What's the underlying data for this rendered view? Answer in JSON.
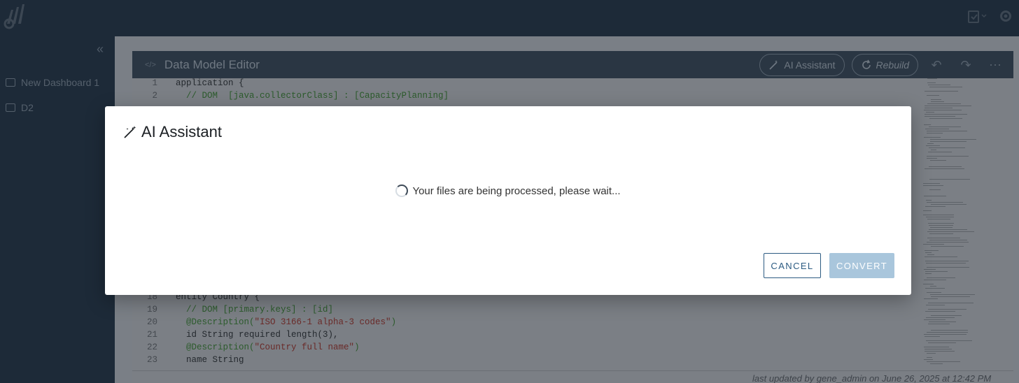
{
  "sidebar": {
    "items": [
      {
        "label": "New Dashboard 1"
      },
      {
        "label": "D2"
      }
    ]
  },
  "editor": {
    "title": "Data Model Editor",
    "ai_button": "AI Assistant",
    "rebuild_button": "Rebuild",
    "lines": [
      {
        "n": "1",
        "text": "application {"
      },
      {
        "n": "2",
        "comment": "  // DOM  [java.collectorClass] : [CapacityPlanning]"
      },
      {
        "n": "18",
        "text": "entity Country {"
      },
      {
        "n": "19",
        "comment": "  // DOM [primary.keys] : [id]"
      },
      {
        "n": "20",
        "comment": "  @Description(",
        "string": "\"ISO 3166-1 alpha-3 codes\"",
        "tail": ")"
      },
      {
        "n": "21",
        "text": "  id String required length(3),"
      },
      {
        "n": "22",
        "comment": "  @Description(",
        "string": "\"Country full name\"",
        "tail": ")"
      },
      {
        "n": "23",
        "text": "  name String"
      }
    ],
    "status": "last updated by gene_admin on June 26, 2025 at 12:42 PM"
  },
  "modal": {
    "title": "AI Assistant",
    "message": "Your files are being processed, please wait...",
    "cancel_label": "CANCEL",
    "convert_label": "CONVERT"
  },
  "colors": {
    "primary": "#2c5b82",
    "disabled_button": "#a9c6dc",
    "topbar": "#1d2a38"
  },
  "icons": [
    "logo-icon",
    "clipboard-icon",
    "gear-icon",
    "collapse-icon",
    "dashboard-icon",
    "code-icon",
    "magic-wand-icon",
    "refresh-icon",
    "undo-icon",
    "redo-icon",
    "more-icon",
    "spinner-icon",
    "clock-icon"
  ]
}
